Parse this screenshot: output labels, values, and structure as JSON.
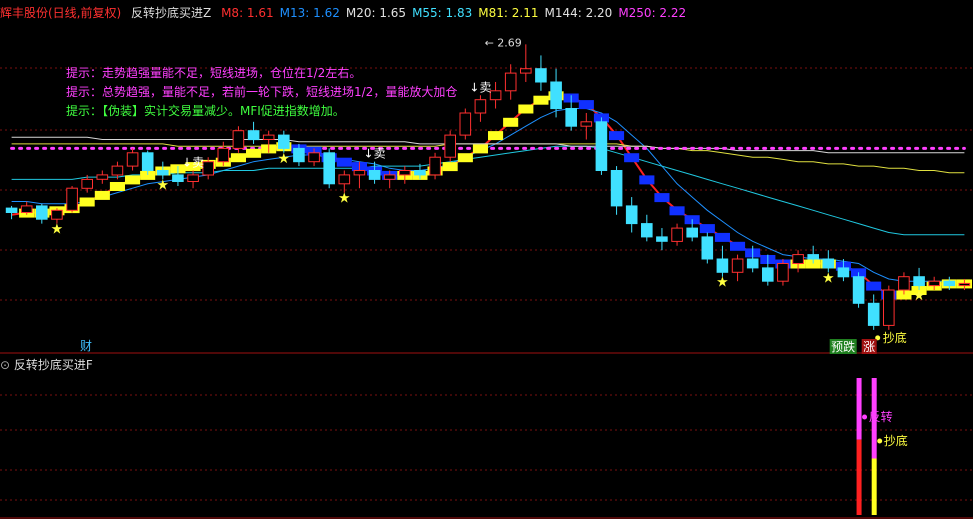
{
  "header": {
    "stock": "辉丰股份(日线,前复权)",
    "indicator": "反转抄底买进Z",
    "ma": [
      {
        "label": "M8: 1.61",
        "color": "#ff3030"
      },
      {
        "label": "M13: 1.62",
        "color": "#1e90ff"
      },
      {
        "label": "M20: 1.65",
        "color": "#e0e0e0"
      },
      {
        "label": "M55: 1.83",
        "color": "#40e0ff"
      },
      {
        "label": "M81: 2.11",
        "color": "#ffff40"
      },
      {
        "label": "M144: 2.20",
        "color": "#e0e0e0"
      },
      {
        "label": "M250: 2.22",
        "color": "#ff40ff"
      }
    ]
  },
  "tips": [
    {
      "text": "提示：走势趋强量能不足，短线进场，仓位在1/2左右。",
      "color": "#ff40ff"
    },
    {
      "text": "提示：总势趋强，量能不足，若前一轮下跌，短线进场1/2，量能放大加仓",
      "color": "#ff40ff"
    },
    {
      "text": "提示：【伪装】实计交易量减少。MFI促进指数增加。",
      "color": "#40ff40"
    }
  ],
  "sub": {
    "title": "反转抄底买进F"
  },
  "chart_data": {
    "type": "candlestick",
    "price_labels": {
      "high": "2.69"
    },
    "annotations": {
      "sell": "卖",
      "cai": "财",
      "chaodi": "抄底",
      "yudie": "预跌",
      "zhang": "涨",
      "fanzhuan": "反转"
    },
    "candles": [
      [
        1.95,
        1.96,
        1.9,
        1.93
      ],
      [
        1.93,
        1.98,
        1.92,
        1.96
      ],
      [
        1.96,
        1.97,
        1.88,
        1.9
      ],
      [
        1.9,
        1.95,
        1.88,
        1.94
      ],
      [
        1.94,
        2.05,
        1.93,
        2.04
      ],
      [
        2.04,
        2.1,
        2.02,
        2.08
      ],
      [
        2.08,
        2.12,
        2.06,
        2.1
      ],
      [
        2.1,
        2.16,
        2.08,
        2.14
      ],
      [
        2.14,
        2.22,
        2.12,
        2.2
      ],
      [
        2.2,
        2.21,
        2.1,
        2.12
      ],
      [
        2.12,
        2.16,
        2.08,
        2.1
      ],
      [
        2.1,
        2.14,
        2.05,
        2.07
      ],
      [
        2.07,
        2.12,
        2.04,
        2.1
      ],
      [
        2.1,
        2.18,
        2.08,
        2.16
      ],
      [
        2.16,
        2.25,
        2.14,
        2.22
      ],
      [
        2.22,
        2.32,
        2.2,
        2.3
      ],
      [
        2.3,
        2.34,
        2.24,
        2.26
      ],
      [
        2.26,
        2.3,
        2.2,
        2.28
      ],
      [
        2.28,
        2.3,
        2.2,
        2.22
      ],
      [
        2.22,
        2.24,
        2.14,
        2.16
      ],
      [
        2.16,
        2.22,
        2.14,
        2.2
      ],
      [
        2.2,
        2.22,
        2.04,
        2.06
      ],
      [
        2.06,
        2.12,
        2.02,
        2.1
      ],
      [
        2.1,
        2.16,
        2.04,
        2.12
      ],
      [
        2.12,
        2.16,
        2.06,
        2.08
      ],
      [
        2.08,
        2.12,
        2.04,
        2.1
      ],
      [
        2.1,
        2.14,
        2.06,
        2.12
      ],
      [
        2.12,
        2.15,
        2.08,
        2.1
      ],
      [
        2.1,
        2.2,
        2.08,
        2.18
      ],
      [
        2.18,
        2.3,
        2.16,
        2.28
      ],
      [
        2.28,
        2.4,
        2.26,
        2.38
      ],
      [
        2.38,
        2.46,
        2.34,
        2.44
      ],
      [
        2.44,
        2.52,
        2.4,
        2.48
      ],
      [
        2.48,
        2.6,
        2.44,
        2.56
      ],
      [
        2.56,
        2.69,
        2.52,
        2.58
      ],
      [
        2.58,
        2.64,
        2.48,
        2.52
      ],
      [
        2.52,
        2.58,
        2.36,
        2.4
      ],
      [
        2.4,
        2.46,
        2.3,
        2.32
      ],
      [
        2.32,
        2.38,
        2.26,
        2.34
      ],
      [
        2.34,
        2.36,
        2.1,
        2.12
      ],
      [
        2.12,
        2.14,
        1.92,
        1.96
      ],
      [
        1.96,
        2.0,
        1.84,
        1.88
      ],
      [
        1.88,
        1.92,
        1.8,
        1.82
      ],
      [
        1.82,
        1.86,
        1.76,
        1.8
      ],
      [
        1.8,
        1.88,
        1.78,
        1.86
      ],
      [
        1.86,
        1.9,
        1.8,
        1.82
      ],
      [
        1.82,
        1.84,
        1.7,
        1.72
      ],
      [
        1.72,
        1.78,
        1.64,
        1.66
      ],
      [
        1.66,
        1.74,
        1.62,
        1.72
      ],
      [
        1.72,
        1.78,
        1.66,
        1.68
      ],
      [
        1.68,
        1.74,
        1.6,
        1.62
      ],
      [
        1.62,
        1.72,
        1.6,
        1.7
      ],
      [
        1.7,
        1.76,
        1.66,
        1.74
      ],
      [
        1.74,
        1.78,
        1.7,
        1.72
      ],
      [
        1.72,
        1.76,
        1.66,
        1.68
      ],
      [
        1.68,
        1.72,
        1.62,
        1.64
      ],
      [
        1.64,
        1.66,
        1.5,
        1.52
      ],
      [
        1.52,
        1.56,
        1.4,
        1.42
      ],
      [
        1.42,
        1.6,
        1.4,
        1.58
      ],
      [
        1.58,
        1.66,
        1.56,
        1.64
      ],
      [
        1.64,
        1.68,
        1.58,
        1.6
      ],
      [
        1.6,
        1.64,
        1.58,
        1.62
      ],
      [
        1.62,
        1.64,
        1.58,
        1.6
      ],
      [
        1.6,
        1.63,
        1.58,
        1.61
      ]
    ],
    "ma": {
      "M8": {
        "color": "#ff2020",
        "values": [
          1.92,
          1.93,
          1.93,
          1.94,
          1.95,
          1.98,
          2.01,
          2.05,
          2.08,
          2.1,
          2.12,
          2.13,
          2.14,
          2.15,
          2.16,
          2.18,
          2.2,
          2.22,
          2.23,
          2.22,
          2.21,
          2.18,
          2.16,
          2.14,
          2.12,
          2.1,
          2.1,
          2.1,
          2.12,
          2.14,
          2.18,
          2.22,
          2.28,
          2.34,
          2.4,
          2.44,
          2.46,
          2.45,
          2.42,
          2.36,
          2.28,
          2.18,
          2.08,
          2.0,
          1.94,
          1.9,
          1.86,
          1.82,
          1.78,
          1.75,
          1.72,
          1.7,
          1.7,
          1.7,
          1.7,
          1.69,
          1.66,
          1.6,
          1.56,
          1.56,
          1.58,
          1.6,
          1.61,
          1.61
        ]
      },
      "M13": {
        "color": "#1e90ff",
        "values": [
          1.98,
          1.98,
          1.97,
          1.97,
          1.97,
          1.98,
          2.0,
          2.02,
          2.04,
          2.06,
          2.07,
          2.08,
          2.09,
          2.1,
          2.12,
          2.14,
          2.16,
          2.17,
          2.18,
          2.19,
          2.19,
          2.18,
          2.17,
          2.16,
          2.15,
          2.13,
          2.12,
          2.12,
          2.13,
          2.15,
          2.18,
          2.21,
          2.24,
          2.28,
          2.32,
          2.36,
          2.39,
          2.4,
          2.4,
          2.38,
          2.34,
          2.28,
          2.22,
          2.14,
          2.06,
          2.0,
          1.94,
          1.89,
          1.84,
          1.8,
          1.77,
          1.74,
          1.73,
          1.72,
          1.72,
          1.71,
          1.7,
          1.66,
          1.63,
          1.62,
          1.62,
          1.62,
          1.62,
          1.62
        ]
      },
      "M55": {
        "color": "#20c8e0",
        "values": [
          2.08,
          2.08,
          2.08,
          2.08,
          2.08,
          2.09,
          2.09,
          2.09,
          2.1,
          2.1,
          2.1,
          2.11,
          2.11,
          2.11,
          2.12,
          2.12,
          2.12,
          2.13,
          2.13,
          2.13,
          2.13,
          2.13,
          2.13,
          2.13,
          2.14,
          2.14,
          2.14,
          2.14,
          2.15,
          2.16,
          2.17,
          2.18,
          2.19,
          2.2,
          2.21,
          2.22,
          2.23,
          2.23,
          2.23,
          2.22,
          2.2,
          2.18,
          2.16,
          2.14,
          2.12,
          2.1,
          2.08,
          2.06,
          2.04,
          2.02,
          2.0,
          1.98,
          1.96,
          1.94,
          1.92,
          1.9,
          1.88,
          1.86,
          1.84,
          1.83,
          1.83,
          1.83,
          1.83,
          1.83
        ]
      },
      "M81": {
        "color": "#e0e040",
        "values": [
          2.24,
          2.24,
          2.24,
          2.24,
          2.24,
          2.24,
          2.24,
          2.24,
          2.24,
          2.24,
          2.24,
          2.23,
          2.23,
          2.23,
          2.23,
          2.23,
          2.23,
          2.23,
          2.23,
          2.23,
          2.23,
          2.23,
          2.23,
          2.23,
          2.23,
          2.23,
          2.23,
          2.23,
          2.23,
          2.24,
          2.24,
          2.24,
          2.24,
          2.24,
          2.24,
          2.24,
          2.24,
          2.24,
          2.24,
          2.24,
          2.24,
          2.23,
          2.23,
          2.22,
          2.22,
          2.21,
          2.21,
          2.2,
          2.19,
          2.18,
          2.18,
          2.17,
          2.16,
          2.16,
          2.15,
          2.15,
          2.14,
          2.14,
          2.13,
          2.13,
          2.12,
          2.12,
          2.11,
          2.11
        ]
      },
      "M144": {
        "color": "#d8d8d8",
        "values": [
          2.27,
          2.27,
          2.27,
          2.27,
          2.27,
          2.27,
          2.26,
          2.26,
          2.26,
          2.26,
          2.26,
          2.26,
          2.26,
          2.26,
          2.26,
          2.26,
          2.26,
          2.26,
          2.26,
          2.25,
          2.25,
          2.25,
          2.25,
          2.25,
          2.25,
          2.25,
          2.25,
          2.24,
          2.24,
          2.24,
          2.24,
          2.24,
          2.24,
          2.24,
          2.24,
          2.24,
          2.24,
          2.23,
          2.23,
          2.23,
          2.23,
          2.23,
          2.23,
          2.22,
          2.22,
          2.22,
          2.22,
          2.22,
          2.21,
          2.21,
          2.21,
          2.21,
          2.21,
          2.21,
          2.2,
          2.2,
          2.2,
          2.2,
          2.2,
          2.2,
          2.2,
          2.2,
          2.2,
          2.2
        ]
      },
      "M250": {
        "color": "#ff40ff",
        "dotted": true,
        "values": [
          2.22,
          2.22,
          2.22,
          2.22,
          2.22,
          2.22,
          2.22,
          2.22,
          2.22,
          2.22,
          2.22,
          2.22,
          2.22,
          2.22,
          2.22,
          2.22,
          2.22,
          2.22,
          2.22,
          2.22,
          2.22,
          2.22,
          2.22,
          2.22,
          2.22,
          2.22,
          2.22,
          2.22,
          2.22,
          2.22,
          2.22,
          2.22,
          2.22,
          2.22,
          2.22,
          2.22,
          2.22,
          2.22,
          2.22,
          2.22,
          2.22,
          2.22,
          2.22,
          2.22,
          2.22,
          2.22,
          2.22,
          2.22,
          2.22,
          2.22,
          2.22,
          2.22,
          2.22,
          2.22,
          2.22,
          2.22,
          2.22,
          2.22,
          2.22,
          2.22,
          2.22,
          2.22,
          2.22,
          2.22
        ]
      }
    },
    "stars": [
      3,
      10,
      18,
      22,
      47,
      54,
      60
    ],
    "sell_marks": [
      12,
      24,
      31
    ],
    "sub_bars": [
      {
        "index": 56,
        "value": 1.0,
        "color": "#ff2020",
        "top_color": "#ff40ff"
      },
      {
        "index": 57,
        "value": 0.75,
        "color": "#ffff20",
        "top_color": "#ff40ff"
      }
    ],
    "ylim": [
      1.3,
      2.8
    ]
  }
}
